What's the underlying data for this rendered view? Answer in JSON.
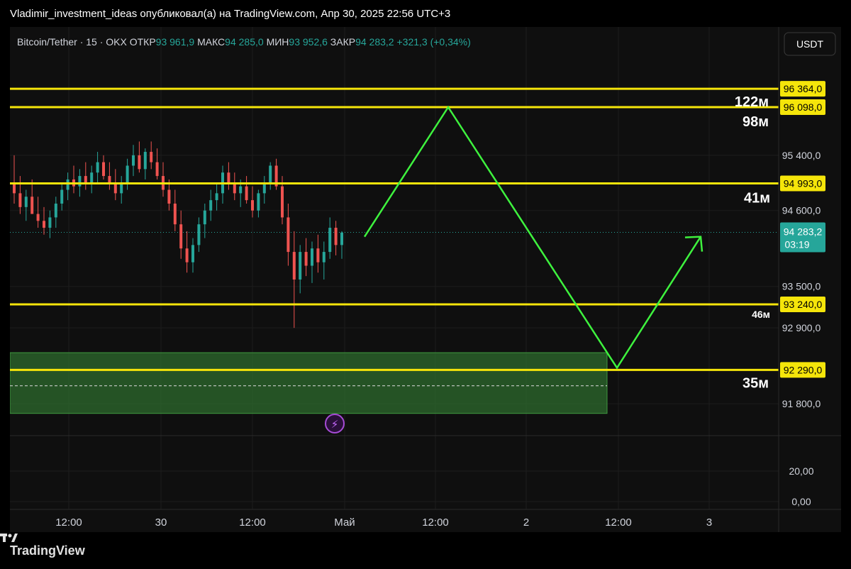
{
  "top_bar": {
    "title": "Vladimir_investment_ideas опубликовал(а) на TradingView.com, Апр 30, 2025 22:56 UTC+3"
  },
  "legend": {
    "symbol": "Bitcoin/Tether · 15 · OKX",
    "open_label": "ОТКР",
    "open_value": "93 961,9",
    "high_label": "МАКС",
    "high_value": "94 285,0",
    "low_label": "МИН",
    "low_value": "93 952,6",
    "close_label": "ЗАКР",
    "close_value": "94 283,2",
    "change": "+321,3 (+0,34%)"
  },
  "currency_button": "USDT",
  "footer": {
    "logo_text": "TradingView"
  },
  "colors": {
    "level_line": "#f5e50a",
    "projection": "#3ef23e",
    "zone_fill": "#2d6b2d",
    "bull": "#26a69a",
    "bear": "#ef5350",
    "price_tag": "#26a69a"
  },
  "chart_data": {
    "type": "candlestick",
    "title": "Bitcoin/Tether · 15 · OKX",
    "y_axis": {
      "ylim": [
        91400,
        96800
      ],
      "ticks": [
        {
          "value": 95400,
          "label": "95 400,0"
        },
        {
          "value": 94600,
          "label": "94 600,0"
        },
        {
          "value": 93500,
          "label": "93 500,0"
        },
        {
          "value": 92900,
          "label": "92 900,0"
        },
        {
          "value": 91800,
          "label": "91 800,0"
        }
      ]
    },
    "x_axis": {
      "ticks": [
        "12:00",
        "30",
        "12:00",
        "Май",
        "12:00",
        "2",
        "12:00",
        "3"
      ]
    },
    "current_price": {
      "label": "94 283,2",
      "countdown": "03:19",
      "value": 94283.2
    },
    "levels": [
      {
        "value": 96364,
        "label": "96 364,0",
        "annotation": ""
      },
      {
        "value": 96098,
        "label": "96 098,0",
        "annotation": "122м"
      },
      {
        "value": 96098,
        "label": "",
        "annotation": "98м"
      },
      {
        "value": 94993,
        "label": "94 993,0",
        "annotation": "41м"
      },
      {
        "value": 93240,
        "label": "93 240,0",
        "annotation": "46м"
      },
      {
        "value": 92290,
        "label": "92 290,0",
        "annotation": "35м"
      }
    ],
    "zone": {
      "top": 92540,
      "bottom": 91660,
      "mid": 92060
    },
    "projection_path": [
      {
        "x": "30 Apr 17:00",
        "y": 94220
      },
      {
        "x": "1 May 12:30",
        "y": 96098
      },
      {
        "x": "2 May 11:00",
        "y": 92320
      },
      {
        "x": "3 May 03:00",
        "y": 94220
      }
    ],
    "candles_ohlc": [
      [
        95000,
        95400,
        94700,
        94850
      ],
      [
        94850,
        95100,
        94550,
        94650
      ],
      [
        94650,
        94900,
        94450,
        94800
      ],
      [
        94800,
        95050,
        94600,
        94550
      ],
      [
        94550,
        94800,
        94350,
        94450
      ],
      [
        94450,
        94650,
        94250,
        94350
      ],
      [
        94350,
        94600,
        94200,
        94500
      ],
      [
        94500,
        94800,
        94350,
        94700
      ],
      [
        94700,
        95000,
        94600,
        94900
      ],
      [
        94900,
        95150,
        94750,
        95050
      ],
      [
        95050,
        95250,
        94850,
        94950
      ],
      [
        94950,
        95200,
        94800,
        95100
      ],
      [
        95100,
        95300,
        94900,
        95000
      ],
      [
        95000,
        95250,
        94850,
        95150
      ],
      [
        95150,
        95450,
        95000,
        95300
      ],
      [
        95300,
        95400,
        95050,
        95100
      ],
      [
        95100,
        95300,
        94900,
        95000
      ],
      [
        95000,
        95200,
        94750,
        94850
      ],
      [
        94850,
        95100,
        94700,
        95000
      ],
      [
        95000,
        95350,
        94900,
        95250
      ],
      [
        95250,
        95550,
        95100,
        95400
      ],
      [
        95400,
        95600,
        95150,
        95200
      ],
      [
        95200,
        95500,
        95050,
        95450
      ],
      [
        95450,
        95600,
        95200,
        95300
      ],
      [
        95300,
        95500,
        95050,
        95100
      ],
      [
        95100,
        95300,
        94800,
        94900
      ],
      [
        94900,
        95050,
        94600,
        94700
      ],
      [
        94700,
        94900,
        94300,
        94400
      ],
      [
        94400,
        94600,
        93900,
        94050
      ],
      [
        94050,
        94300,
        93700,
        93850
      ],
      [
        93850,
        94200,
        93700,
        94100
      ],
      [
        94100,
        94500,
        94000,
        94400
      ],
      [
        94400,
        94700,
        94200,
        94600
      ],
      [
        94600,
        94900,
        94450,
        94750
      ],
      [
        94750,
        95000,
        94600,
        94850
      ],
      [
        94850,
        95250,
        94700,
        95150
      ],
      [
        95150,
        95300,
        94900,
        95000
      ],
      [
        95000,
        95150,
        94750,
        94850
      ],
      [
        94850,
        95050,
        94650,
        94950
      ],
      [
        94950,
        95100,
        94700,
        94750
      ],
      [
        94750,
        94950,
        94500,
        94600
      ],
      [
        94600,
        94900,
        94500,
        94850
      ],
      [
        94850,
        95100,
        94700,
        95000
      ],
      [
        95000,
        95300,
        94900,
        95250
      ],
      [
        95250,
        95350,
        94900,
        94950
      ],
      [
        94950,
        95100,
        94400,
        94500
      ],
      [
        94500,
        94700,
        93800,
        94000
      ],
      [
        94000,
        94300,
        92900,
        93600
      ],
      [
        93600,
        94100,
        93400,
        94000
      ],
      [
        94000,
        94200,
        93650,
        93800
      ],
      [
        93800,
        94150,
        93550,
        94050
      ],
      [
        94050,
        94250,
        93700,
        93850
      ],
      [
        93850,
        94150,
        93600,
        94000
      ],
      [
        94000,
        94500,
        93900,
        94350
      ],
      [
        94350,
        94450,
        93950,
        94100
      ],
      [
        94100,
        94300,
        93900,
        94280
      ]
    ]
  }
}
